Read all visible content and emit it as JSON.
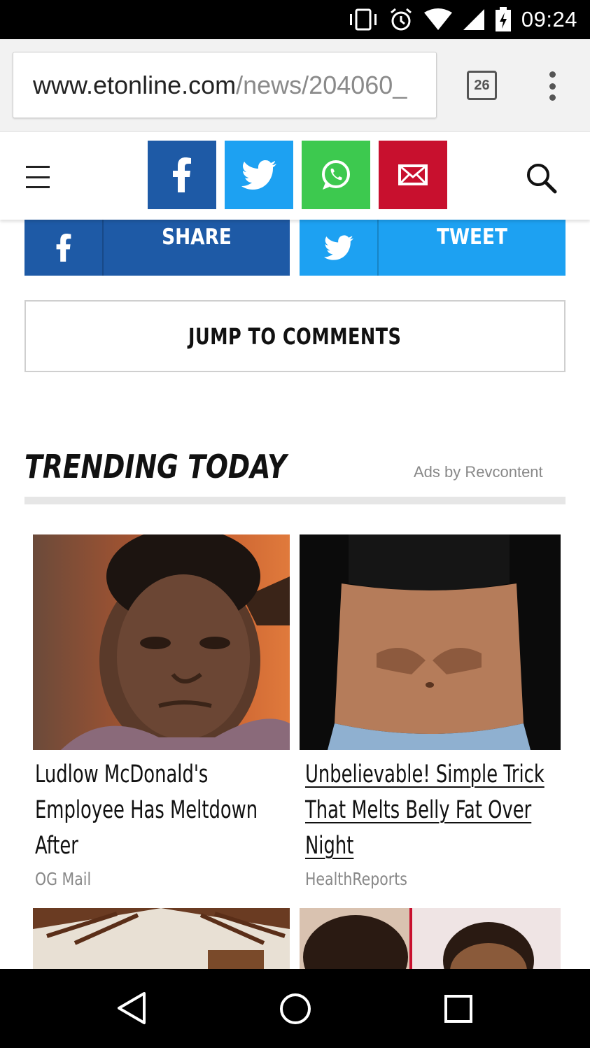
{
  "status_bar": {
    "time": "09:24",
    "icons": [
      "vibrate-icon",
      "alarm-icon",
      "wifi-icon",
      "signal-icon",
      "battery-charging-icon"
    ]
  },
  "browser": {
    "url_domain": "www.etonline.com",
    "url_path": "/news/204060_",
    "tab_count": "26",
    "menu_icon": "overflow-menu-icon"
  },
  "site_header": {
    "menu_icon": "hamburger-menu-icon",
    "share_buttons": [
      {
        "name": "facebook",
        "icon": "facebook-icon",
        "color": "#1e5aa6"
      },
      {
        "name": "twitter",
        "icon": "twitter-icon",
        "color": "#1da1f2"
      },
      {
        "name": "whatsapp",
        "icon": "whatsapp-icon",
        "color": "#3dc94f"
      },
      {
        "name": "email",
        "icon": "email-icon",
        "color": "#c8102e"
      }
    ],
    "search_icon": "search-icon"
  },
  "share_strip": {
    "facebook_label": "SHARE",
    "twitter_label": "TWEET",
    "facebook_color": "#1e5aa6",
    "twitter_color": "#1da1f2"
  },
  "jump_to_comments": "JUMP TO COMMENTS",
  "trending": {
    "title": "TRENDING TODAY",
    "ads_label": "Ads by Revcontent",
    "cards": [
      {
        "title": "Ludlow McDonald's Employee Has Meltdown After",
        "source": "OG Mail"
      },
      {
        "title": "Unbelievable! Simple Trick That Melts Belly Fat Over Night",
        "source": "HealthReports"
      }
    ]
  },
  "nav_bar": {
    "icons": [
      "back-icon",
      "home-icon",
      "recents-icon"
    ]
  }
}
